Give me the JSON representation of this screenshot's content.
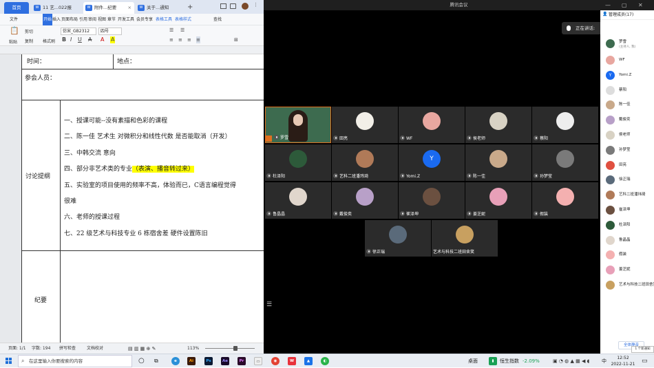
{
  "wps": {
    "tabs": {
      "home": "首页",
      "tab1": "11 艺...022报",
      "tab2": "附件...纪要",
      "tab3": "关于...通知",
      "add": "+"
    },
    "menu": {
      "file": "文件",
      "start": "开始",
      "insert": "插入",
      "layout": "页面布局",
      "ref": "引用",
      "review": "审阅",
      "view": "视图",
      "chapter": "章节",
      "dev": "开发工具",
      "member": "会员专享",
      "table_tools": "表格工具",
      "table_style": "表格样式",
      "search": "查找"
    },
    "ribbon": {
      "paste": "粘贴",
      "cut": "剪切",
      "copy": "复制",
      "format_painter": "格式刷",
      "font": "仿宋_GB2312",
      "size": "四号"
    },
    "doc": {
      "time_label": "时间：",
      "place_label": "地点：",
      "attendees_label": "参会人员：",
      "discussion_label": "讨论提纲",
      "minutes_label": "纪要",
      "items": [
        "一、授课可能--没有素描和色彩的课程",
        "二、陈一佳 艺术生 对微积分和线性代数 是否能取消（开发）",
        "三、中韩交流 意向",
        "四、部分非艺术类的专业",
        "五、实验室的项目使用的频率不高，体验而已，C语言编程觉得",
        "很难",
        "六、老师的授课过程",
        "七、22 级艺术与科技专业 6 栋宿舍差 硬件设置陈旧"
      ],
      "highlight": "（表演、播音转过来）"
    },
    "status": {
      "page": "页面: 1/1",
      "words": "字数: 194",
      "spell": "拼写检查",
      "proof": "文档校对",
      "zoom": "113%"
    }
  },
  "meeting": {
    "title": "腾讯会议",
    "speaking_label": "正在讲话:",
    "tiles": [
      {
        "name": "罗雪",
        "color": "#3d6b4f"
      },
      {
        "name": "田亮",
        "color": "#f2efe8"
      },
      {
        "name": "WF",
        "color": "#e8a7a0"
      },
      {
        "name": "侯老师",
        "color": "#d8d2c4"
      },
      {
        "name": "蔡阳",
        "color": "#eeeeee"
      },
      {
        "name": "杜泽阳",
        "color": "#2d5a3a"
      },
      {
        "name": "艺科二班潘玮琦",
        "color": "#b07a58"
      },
      {
        "name": "Yomi.Z",
        "color": "#1a6af0"
      },
      {
        "name": "陈一佳",
        "color": "#c9a98a"
      },
      {
        "name": "孙梦莹",
        "color": "#7a7a7a"
      },
      {
        "name": "鲁晶晶",
        "color": "#e0d6cc"
      },
      {
        "name": "戴俊奕",
        "color": "#b8a0c8"
      },
      {
        "name": "崔泽坤",
        "color": "#6b5040"
      },
      {
        "name": "姜芝妮",
        "color": "#e8a0b8"
      },
      {
        "name": "假装",
        "color": "#f4b0b0"
      },
      {
        "name": "徐正瑞",
        "color": "#5a6a7a"
      },
      {
        "name": "艺术与科技二班田舍笑",
        "color": "#c8a060"
      }
    ],
    "tile_avatar_letter": "Y",
    "panel": {
      "header": "管理成员(17)",
      "members": [
        {
          "name": "罗雪",
          "sub": "(主持人, 我)",
          "color": "#3d6b4f"
        },
        {
          "name": "WF",
          "color": "#e8a7a0"
        },
        {
          "name": "Yomi.Z",
          "color": "#1a6af0"
        },
        {
          "name": "蔡阳",
          "color": "#dddddd"
        },
        {
          "name": "陈一佳",
          "color": "#c9a98a"
        },
        {
          "name": "戴俊奕",
          "color": "#b8a0c8"
        },
        {
          "name": "侯老师",
          "color": "#d8d2c4"
        },
        {
          "name": "孙梦莹",
          "color": "#7a7a7a"
        },
        {
          "name": "田亮",
          "color": "#e05040"
        },
        {
          "name": "徐正瑞",
          "color": "#5a6a7a"
        },
        {
          "name": "艺科二班潘玮琦",
          "color": "#b07a58"
        },
        {
          "name": "崔泽坤",
          "color": "#6b5040"
        },
        {
          "name": "杜泽阳",
          "color": "#2d5a3a"
        },
        {
          "name": "鲁晶晶",
          "color": "#e0d6cc"
        },
        {
          "name": "假装",
          "color": "#f4b0b0"
        },
        {
          "name": "姜芝妮",
          "color": "#e8a0b8"
        },
        {
          "name": "艺术与科技二班田舍笑",
          "color": "#c8a060"
        }
      ],
      "mute_all": "全体静音",
      "notice": "1 个新通知"
    }
  },
  "taskbar": {
    "search_placeholder": "在这里输入你要搜索的内容",
    "desktop": "桌面",
    "stock_name": "恒生指数",
    "stock_change": "-2.09%",
    "ime": "中",
    "time": "12:52",
    "date": "2022-11-21"
  },
  "colors": {
    "accent": "#2f6fe0",
    "highlight": "#ffff00",
    "stock_down": "#1aa055"
  }
}
